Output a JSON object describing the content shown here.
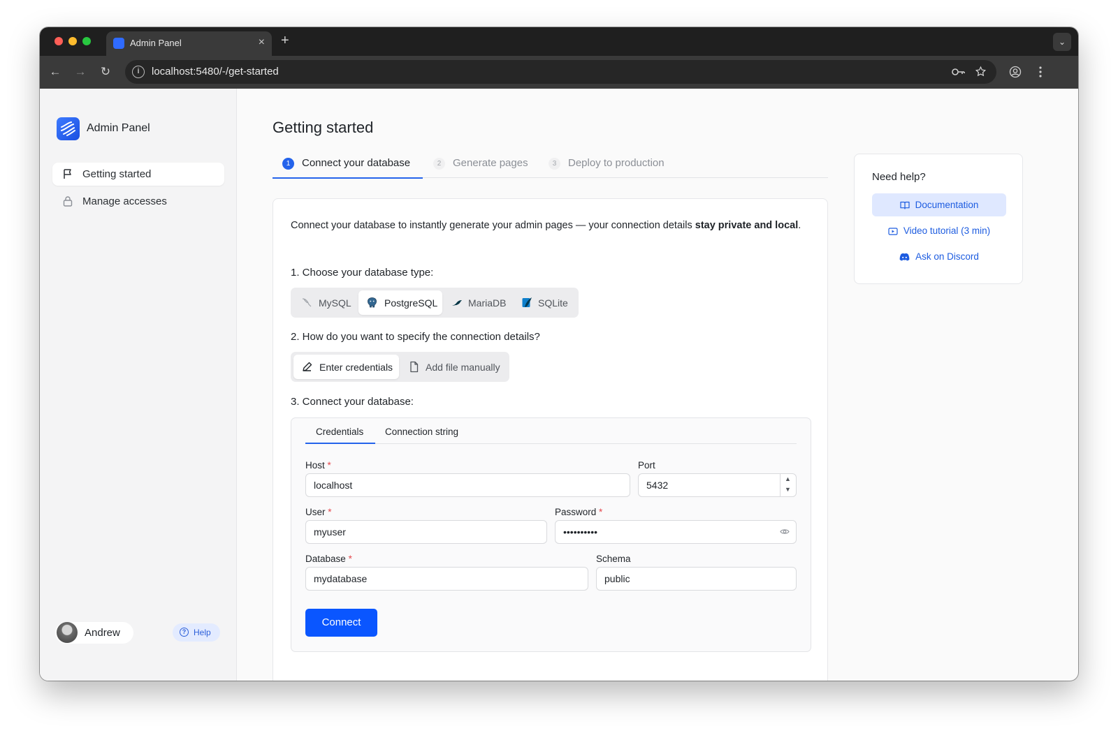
{
  "browser": {
    "tab_title": "Admin Panel",
    "tab_close": "×",
    "new_tab": "+",
    "url": "localhost:5480/-/get-started"
  },
  "sidebar": {
    "brand": "Admin Panel",
    "items": [
      {
        "label": "Getting started",
        "icon": "flag-icon",
        "active": true
      },
      {
        "label": "Manage accesses",
        "icon": "lock-icon",
        "active": false
      }
    ],
    "user_name": "Andrew",
    "help_label": "Help"
  },
  "main": {
    "title": "Getting started",
    "steps": [
      {
        "num": "1",
        "label": "Connect your database",
        "active": true
      },
      {
        "num": "2",
        "label": "Generate pages",
        "active": false
      },
      {
        "num": "3",
        "label": "Deploy to production",
        "active": false
      }
    ],
    "intro_text": "Connect your database to instantly generate your admin pages — your connection details ",
    "intro_bold": "stay private and local",
    "intro_end": ".",
    "q1": "1. Choose your database type:",
    "db_types": [
      {
        "label": "MySQL",
        "icon": "mysql-dolphin-icon",
        "active": false
      },
      {
        "label": "PostgreSQL",
        "icon": "postgresql-elephant-icon",
        "active": true
      },
      {
        "label": "MariaDB",
        "icon": "mariadb-seal-icon",
        "active": false
      },
      {
        "label": "SQLite",
        "icon": "sqlite-feather-icon",
        "active": false
      }
    ],
    "q2": "2. How do you want to specify the connection details?",
    "spec_modes": [
      {
        "label": "Enter credentials",
        "icon": "pencil-icon",
        "active": true
      },
      {
        "label": "Add file manually",
        "icon": "file-icon",
        "active": false
      }
    ],
    "q3": "3. Connect your database:",
    "conn_tabs": [
      {
        "label": "Credentials",
        "active": true
      },
      {
        "label": "Connection string",
        "active": false
      }
    ],
    "fields": {
      "host": {
        "label": "Host",
        "required": "*",
        "value": "localhost"
      },
      "port": {
        "label": "Port",
        "value": "5432"
      },
      "user": {
        "label": "User",
        "required": "*",
        "value": "myuser"
      },
      "password": {
        "label": "Password",
        "required": "*",
        "value": "••••••••••"
      },
      "database": {
        "label": "Database",
        "required": "*",
        "value": "mydatabase"
      },
      "schema": {
        "label": "Schema",
        "value": "public"
      }
    },
    "connect_label": "Connect"
  },
  "help_panel": {
    "title": "Need help?",
    "links": [
      {
        "label": "Documentation",
        "icon": "book-icon",
        "primary": true
      },
      {
        "label": "Video tutorial (3 min)",
        "icon": "video-icon",
        "primary": false
      },
      {
        "label": "Ask on Discord",
        "icon": "discord-icon",
        "primary": false
      }
    ]
  },
  "colors": {
    "accent": "#2463eb",
    "primary_button": "#0a56ff",
    "required": "#e5484d"
  }
}
